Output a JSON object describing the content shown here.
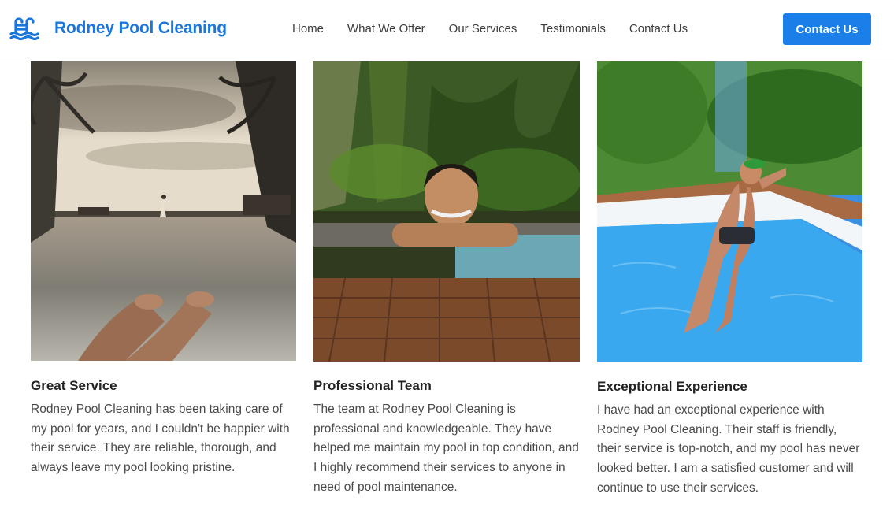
{
  "header": {
    "brand_name": "Rodney Pool Cleaning",
    "logo_icon": "pool-ladder-waves-icon",
    "nav": [
      {
        "label": "Home",
        "active": false
      },
      {
        "label": "What We Offer",
        "active": false
      },
      {
        "label": "Our Services",
        "active": false
      },
      {
        "label": "Testimonials",
        "active": true
      },
      {
        "label": "Contact Us",
        "active": false
      }
    ],
    "cta_label": "Contact Us"
  },
  "colors": {
    "brand": "#1876dd",
    "button": "#1a7fe8",
    "text": "#222222",
    "body_text": "#4a4a4a"
  },
  "testimonials": [
    {
      "image": "infinity-pool-sunset-photo",
      "title": "Great Service",
      "text": "Rodney Pool Cleaning has been taking care of my pool for years, and I couldn't be happier with their service. They are reliable, thorough, and always leave my pool looking pristine."
    },
    {
      "image": "smiling-man-in-pool-photo",
      "title": "Professional Team",
      "text": "The team at Rodney Pool Cleaning is professional and knowledgeable. They have helped me maintain my pool in top condition, and I highly recommend their services to anyone in need of pool maintenance."
    },
    {
      "image": "man-floating-in-pool-photo",
      "title": "Exceptional Experience",
      "text": "I have had an exceptional experience with Rodney Pool Cleaning. Their staff is friendly, their service is top-notch, and my pool has never looked better. I am a satisfied customer and will continue to use their services."
    }
  ]
}
